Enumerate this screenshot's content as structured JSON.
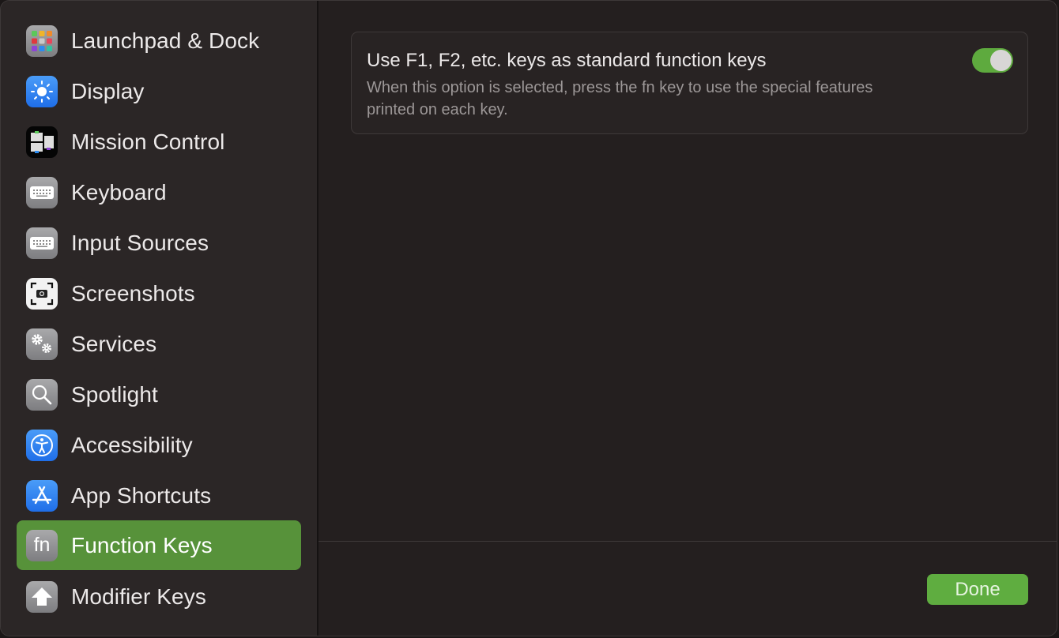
{
  "sidebar": {
    "items": [
      {
        "label": "Launchpad & Dock",
        "icon": "launchpad-icon"
      },
      {
        "label": "Display",
        "icon": "display-brightness-icon"
      },
      {
        "label": "Mission Control",
        "icon": "mission-control-icon"
      },
      {
        "label": "Keyboard",
        "icon": "keyboard-icon"
      },
      {
        "label": "Input Sources",
        "icon": "keyboard-icon"
      },
      {
        "label": "Screenshots",
        "icon": "screenshot-camera-icon"
      },
      {
        "label": "Services",
        "icon": "gears-icon"
      },
      {
        "label": "Spotlight",
        "icon": "magnifier-icon"
      },
      {
        "label": "Accessibility",
        "icon": "accessibility-icon"
      },
      {
        "label": "App Shortcuts",
        "icon": "app-store-icon"
      },
      {
        "label": "Function Keys",
        "icon": "fn-icon",
        "selected": true
      },
      {
        "label": "Modifier Keys",
        "icon": "shift-arrow-icon"
      }
    ]
  },
  "main": {
    "option": {
      "title": "Use F1, F2, etc. keys as standard function keys",
      "description": "When this option is selected, press the fn key to use the special features printed on each key.",
      "enabled": true
    },
    "done_label": "Done",
    "fn_glyph": "fn"
  },
  "colors": {
    "accent": "#57923a",
    "toggle_on": "#5eaa3e",
    "done_button": "#5fad40"
  }
}
